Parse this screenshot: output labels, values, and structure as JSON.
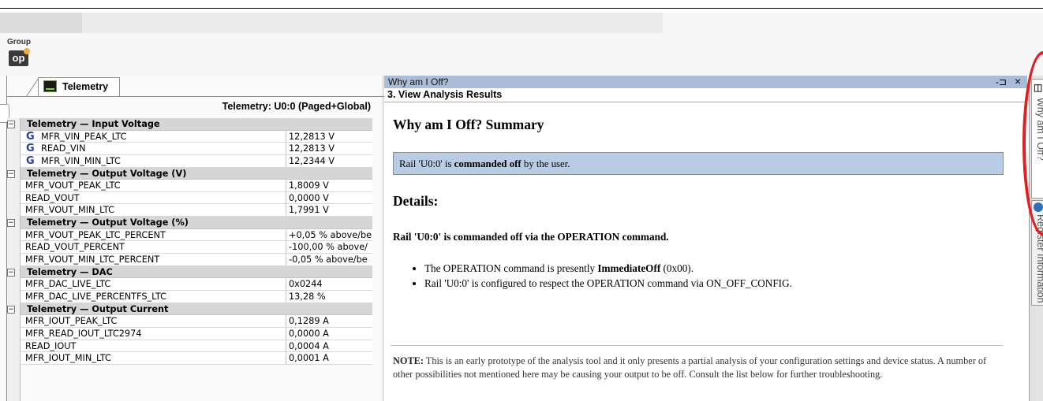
{
  "toolbar": {
    "group_label": "Group",
    "op_button_label": "op"
  },
  "left_panel": {
    "tab_label": "Telemetry",
    "tab_icon": "telemetry-graph-icon",
    "title": "Telemetry: U0:0 (Paged+Global)",
    "groups": [
      {
        "label": "Telemetry — Input Voltage",
        "rows": [
          {
            "name": "MFR_VIN_PEAK_LTC",
            "value": "12,2813 V",
            "global": true
          },
          {
            "name": "READ_VIN",
            "value": "12,2813 V",
            "global": true
          },
          {
            "name": "MFR_VIN_MIN_LTC",
            "value": "12,2344 V",
            "global": true
          }
        ]
      },
      {
        "label": "Telemetry — Output Voltage (V)",
        "rows": [
          {
            "name": "MFR_VOUT_PEAK_LTC",
            "value": "1,8009 V"
          },
          {
            "name": "READ_VOUT",
            "value": "0,0000 V"
          },
          {
            "name": "MFR_VOUT_MIN_LTC",
            "value": "1,7991 V"
          }
        ]
      },
      {
        "label": "Telemetry — Output Voltage (%)",
        "rows": [
          {
            "name": "MFR_VOUT_PEAK_LTC_PERCENT",
            "value": "+0,05 % above/be"
          },
          {
            "name": "READ_VOUT_PERCENT",
            "value": "-100,00 % above/"
          },
          {
            "name": "MFR_VOUT_MIN_LTC_PERCENT",
            "value": "-0,05 % above/be"
          }
        ]
      },
      {
        "label": "Telemetry — DAC",
        "rows": [
          {
            "name": "MFR_DAC_LIVE_LTC",
            "value": "0x0244"
          },
          {
            "name": "MFR_DAC_LIVE_PERCENTFS_LTC",
            "value": "13,28 %"
          }
        ]
      },
      {
        "label": "Telemetry — Output Current",
        "rows": [
          {
            "name": "MFR_IOUT_PEAK_LTC",
            "value": "0,1289 A"
          },
          {
            "name": "MFR_READ_IOUT_LTC2974",
            "value": "0,0000 A"
          },
          {
            "name": "READ_IOUT",
            "value": "0,0004 A"
          },
          {
            "name": "MFR_IOUT_MIN_LTC",
            "value": "0,0001 A"
          }
        ]
      }
    ]
  },
  "why_panel": {
    "title": "Why am I Off?",
    "pin_glyph": "-⊐",
    "close_glyph": "×",
    "step_label": "3. View Analysis Results",
    "heading": "Why am I Off? Summary",
    "summary_prefix": "Rail 'U0:0' is ",
    "summary_bold": "commanded off",
    "summary_suffix": " by the user.",
    "details_heading": "Details:",
    "command_line": "Rail 'U0:0' is commanded off via the OPERATION command.",
    "bullet1_prefix": "The OPERATION command is presently ",
    "bullet1_bold": "ImmediateOff",
    "bullet1_suffix": " (0x00).",
    "bullet2": "Rail 'U0:0' is configured to respect the OPERATION command via ON_OFF_CONFIG.",
    "note_label": "NOTE:",
    "note_text": " This is an early prototype of the analysis tool and it only presents a partial analysis of your configuration settings and device status. A number of other possibilities not mentioned here may be causing your output to be off. Consult the list below for further troubleshooting."
  },
  "side_tabs": {
    "tab1_label": "Why am I Off?",
    "tab1_icon": "document-icon",
    "tab2_label": "Register Information",
    "tab2_icon": "info-circle-icon"
  },
  "annotation_color": "#e02020"
}
